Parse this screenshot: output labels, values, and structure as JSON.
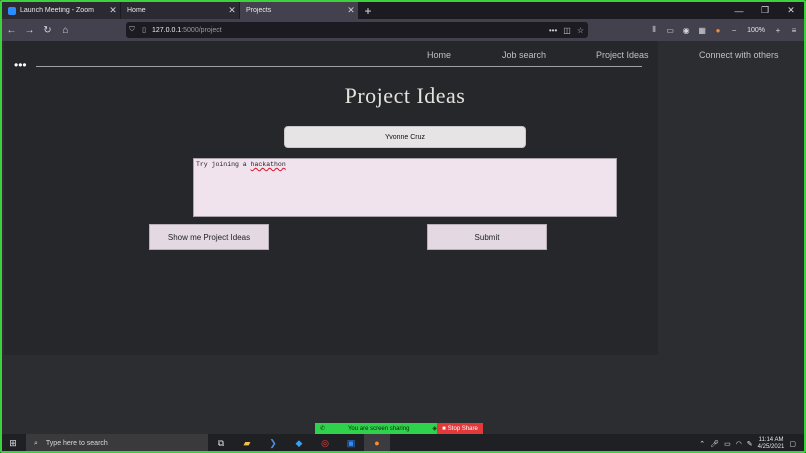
{
  "browser": {
    "tabs": [
      {
        "title": "Launch Meeting - Zoom",
        "favicon_color": "#2d8cff"
      },
      {
        "title": "Home",
        "favicon_color": "#1c1b22"
      },
      {
        "title": "Projects",
        "favicon_color": "#42414d"
      }
    ],
    "new_tab_icon": "+",
    "url_host": "127.0.0.1",
    "url_path": ":5000/project",
    "zoom_level": "100%"
  },
  "site": {
    "nav": {
      "home": "Home",
      "job_search": "Job search",
      "project_ideas": "Project Ideas",
      "connect": "Connect with others"
    },
    "page_title": "Project Ideas",
    "name_value": "Yvonne Cruz",
    "idea_text_prefix": "Try joining a ",
    "idea_text_word": "hackathon",
    "show_button": "Show me Project Ideas",
    "submit_button": "Submit"
  },
  "zoom_banner": {
    "sharing_text": "You are screen sharing",
    "stop_text": "Stop Share"
  },
  "taskbar": {
    "search_placeholder": "Type here to search",
    "time": "11:14 AM",
    "date": "4/25/2021"
  },
  "colors": {
    "frame_border": "#3dd23d",
    "page_bg": "#26272a",
    "textarea_bg": "#f0e3ee",
    "button_bg": "#e4d9e3",
    "share_green": "#2fd24b",
    "share_red": "#e23a3a"
  }
}
